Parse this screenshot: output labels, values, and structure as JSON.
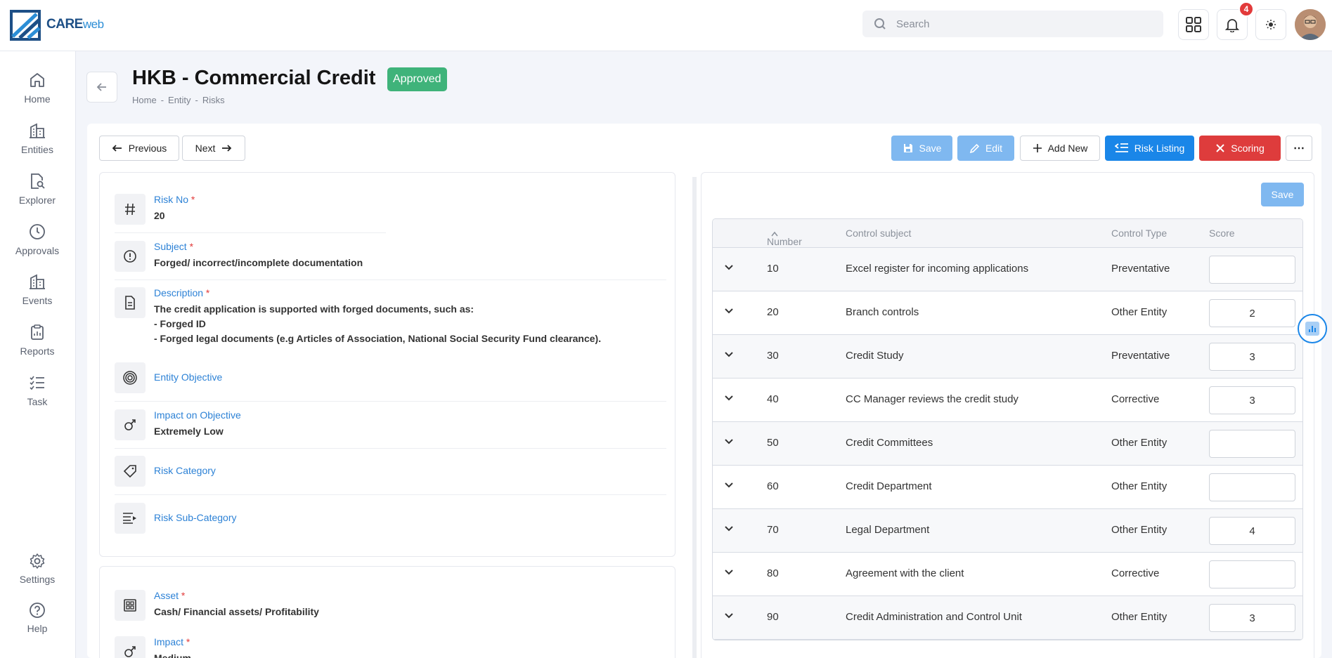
{
  "app": {
    "logo_main": "CARE",
    "logo_sub": "web"
  },
  "topbar": {
    "search_placeholder": "Search",
    "notification_count": "4"
  },
  "sidebar": {
    "items": [
      {
        "label": "Home",
        "icon": "home-icon"
      },
      {
        "label": "Entities",
        "icon": "building-icon"
      },
      {
        "label": "Explorer",
        "icon": "file-search-icon"
      },
      {
        "label": "Approvals",
        "icon": "clock-icon"
      },
      {
        "label": "Events",
        "icon": "building-icon"
      },
      {
        "label": "Reports",
        "icon": "clipboard-icon"
      },
      {
        "label": "Task",
        "icon": "checklist-icon"
      }
    ],
    "bottom": [
      {
        "label": "Settings",
        "icon": "gear-icon"
      },
      {
        "label": "Help",
        "icon": "help-icon"
      }
    ]
  },
  "header": {
    "title": "HKB - Commercial Credit",
    "status": "Approved",
    "breadcrumb": [
      "Home",
      "-",
      "Entity",
      "-",
      "Risks"
    ]
  },
  "toolbar": {
    "previous": "Previous",
    "next": "Next",
    "save": "Save",
    "edit": "Edit",
    "add_new": "Add New",
    "risk_listing": "Risk Listing",
    "scoring": "Scoring",
    "more": "⋯"
  },
  "fields": {
    "risk_no": {
      "label": "Risk No",
      "required": "*",
      "value": "20"
    },
    "subject": {
      "label": "Subject",
      "required": "*",
      "value": "Forged/ incorrect/incomplete documentation"
    },
    "description": {
      "label": "Description",
      "required": "*",
      "lines": [
        "The credit application is supported with forged documents, such as:",
        "- Forged ID",
        "- Forged legal documents (e.g Articles of Association, National Social Security Fund clearance)."
      ]
    },
    "entity_objective": {
      "label": "Entity Objective"
    },
    "impact_on_objective": {
      "label": "Impact on Objective",
      "value": "Extremely Low"
    },
    "risk_category": {
      "label": "Risk Category"
    },
    "risk_sub_category": {
      "label": "Risk Sub-Category"
    },
    "asset": {
      "label": "Asset",
      "required": "*",
      "value": "Cash/ Financial assets/ Profitability"
    },
    "impact": {
      "label": "Impact",
      "required": "*",
      "value": "Medium"
    }
  },
  "controls": {
    "save_label": "Save",
    "columns": {
      "number": "Number",
      "subject": "Control subject",
      "type": "Control Type",
      "score": "Score"
    },
    "rows": [
      {
        "number": "10",
        "subject": "Excel register for incoming applications",
        "type": "Preventative",
        "score": ""
      },
      {
        "number": "20",
        "subject": "Branch controls",
        "type": "Other Entity",
        "score": "2"
      },
      {
        "number": "30",
        "subject": "Credit Study",
        "type": "Preventative",
        "score": "3"
      },
      {
        "number": "40",
        "subject": "CC Manager reviews the credit study",
        "type": "Corrective",
        "score": "3"
      },
      {
        "number": "50",
        "subject": "Credit Committees",
        "type": "Other Entity",
        "score": ""
      },
      {
        "number": "60",
        "subject": "Credit Department",
        "type": "Other Entity",
        "score": ""
      },
      {
        "number": "70",
        "subject": "Legal Department",
        "type": "Other Entity",
        "score": "4"
      },
      {
        "number": "80",
        "subject": "Agreement with the client",
        "type": "Corrective",
        "score": ""
      },
      {
        "number": "90",
        "subject": "Credit Administration and Control Unit",
        "type": "Other Entity",
        "score": "3"
      }
    ]
  },
  "colors": {
    "accent": "#1a86e8",
    "approved": "#3fb37a",
    "danger": "#de3c3c",
    "label_blue": "#2d82d6"
  }
}
